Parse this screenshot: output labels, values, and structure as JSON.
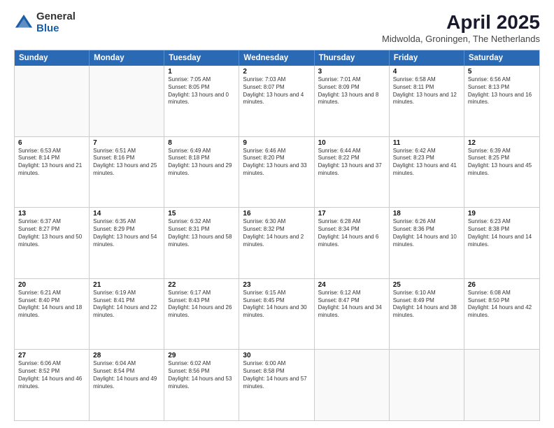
{
  "logo": {
    "general": "General",
    "blue": "Blue"
  },
  "title": "April 2025",
  "subtitle": "Midwolda, Groningen, The Netherlands",
  "header_days": [
    "Sunday",
    "Monday",
    "Tuesday",
    "Wednesday",
    "Thursday",
    "Friday",
    "Saturday"
  ],
  "weeks": [
    [
      {
        "day": "",
        "info": ""
      },
      {
        "day": "",
        "info": ""
      },
      {
        "day": "1",
        "info": "Sunrise: 7:05 AM\nSunset: 8:05 PM\nDaylight: 13 hours and 0 minutes."
      },
      {
        "day": "2",
        "info": "Sunrise: 7:03 AM\nSunset: 8:07 PM\nDaylight: 13 hours and 4 minutes."
      },
      {
        "day": "3",
        "info": "Sunrise: 7:01 AM\nSunset: 8:09 PM\nDaylight: 13 hours and 8 minutes."
      },
      {
        "day": "4",
        "info": "Sunrise: 6:58 AM\nSunset: 8:11 PM\nDaylight: 13 hours and 12 minutes."
      },
      {
        "day": "5",
        "info": "Sunrise: 6:56 AM\nSunset: 8:13 PM\nDaylight: 13 hours and 16 minutes."
      }
    ],
    [
      {
        "day": "6",
        "info": "Sunrise: 6:53 AM\nSunset: 8:14 PM\nDaylight: 13 hours and 21 minutes."
      },
      {
        "day": "7",
        "info": "Sunrise: 6:51 AM\nSunset: 8:16 PM\nDaylight: 13 hours and 25 minutes."
      },
      {
        "day": "8",
        "info": "Sunrise: 6:49 AM\nSunset: 8:18 PM\nDaylight: 13 hours and 29 minutes."
      },
      {
        "day": "9",
        "info": "Sunrise: 6:46 AM\nSunset: 8:20 PM\nDaylight: 13 hours and 33 minutes."
      },
      {
        "day": "10",
        "info": "Sunrise: 6:44 AM\nSunset: 8:22 PM\nDaylight: 13 hours and 37 minutes."
      },
      {
        "day": "11",
        "info": "Sunrise: 6:42 AM\nSunset: 8:23 PM\nDaylight: 13 hours and 41 minutes."
      },
      {
        "day": "12",
        "info": "Sunrise: 6:39 AM\nSunset: 8:25 PM\nDaylight: 13 hours and 45 minutes."
      }
    ],
    [
      {
        "day": "13",
        "info": "Sunrise: 6:37 AM\nSunset: 8:27 PM\nDaylight: 13 hours and 50 minutes."
      },
      {
        "day": "14",
        "info": "Sunrise: 6:35 AM\nSunset: 8:29 PM\nDaylight: 13 hours and 54 minutes."
      },
      {
        "day": "15",
        "info": "Sunrise: 6:32 AM\nSunset: 8:31 PM\nDaylight: 13 hours and 58 minutes."
      },
      {
        "day": "16",
        "info": "Sunrise: 6:30 AM\nSunset: 8:32 PM\nDaylight: 14 hours and 2 minutes."
      },
      {
        "day": "17",
        "info": "Sunrise: 6:28 AM\nSunset: 8:34 PM\nDaylight: 14 hours and 6 minutes."
      },
      {
        "day": "18",
        "info": "Sunrise: 6:26 AM\nSunset: 8:36 PM\nDaylight: 14 hours and 10 minutes."
      },
      {
        "day": "19",
        "info": "Sunrise: 6:23 AM\nSunset: 8:38 PM\nDaylight: 14 hours and 14 minutes."
      }
    ],
    [
      {
        "day": "20",
        "info": "Sunrise: 6:21 AM\nSunset: 8:40 PM\nDaylight: 14 hours and 18 minutes."
      },
      {
        "day": "21",
        "info": "Sunrise: 6:19 AM\nSunset: 8:41 PM\nDaylight: 14 hours and 22 minutes."
      },
      {
        "day": "22",
        "info": "Sunrise: 6:17 AM\nSunset: 8:43 PM\nDaylight: 14 hours and 26 minutes."
      },
      {
        "day": "23",
        "info": "Sunrise: 6:15 AM\nSunset: 8:45 PM\nDaylight: 14 hours and 30 minutes."
      },
      {
        "day": "24",
        "info": "Sunrise: 6:12 AM\nSunset: 8:47 PM\nDaylight: 14 hours and 34 minutes."
      },
      {
        "day": "25",
        "info": "Sunrise: 6:10 AM\nSunset: 8:49 PM\nDaylight: 14 hours and 38 minutes."
      },
      {
        "day": "26",
        "info": "Sunrise: 6:08 AM\nSunset: 8:50 PM\nDaylight: 14 hours and 42 minutes."
      }
    ],
    [
      {
        "day": "27",
        "info": "Sunrise: 6:06 AM\nSunset: 8:52 PM\nDaylight: 14 hours and 46 minutes."
      },
      {
        "day": "28",
        "info": "Sunrise: 6:04 AM\nSunset: 8:54 PM\nDaylight: 14 hours and 49 minutes."
      },
      {
        "day": "29",
        "info": "Sunrise: 6:02 AM\nSunset: 8:56 PM\nDaylight: 14 hours and 53 minutes."
      },
      {
        "day": "30",
        "info": "Sunrise: 6:00 AM\nSunset: 8:58 PM\nDaylight: 14 hours and 57 minutes."
      },
      {
        "day": "",
        "info": ""
      },
      {
        "day": "",
        "info": ""
      },
      {
        "day": "",
        "info": ""
      }
    ]
  ]
}
